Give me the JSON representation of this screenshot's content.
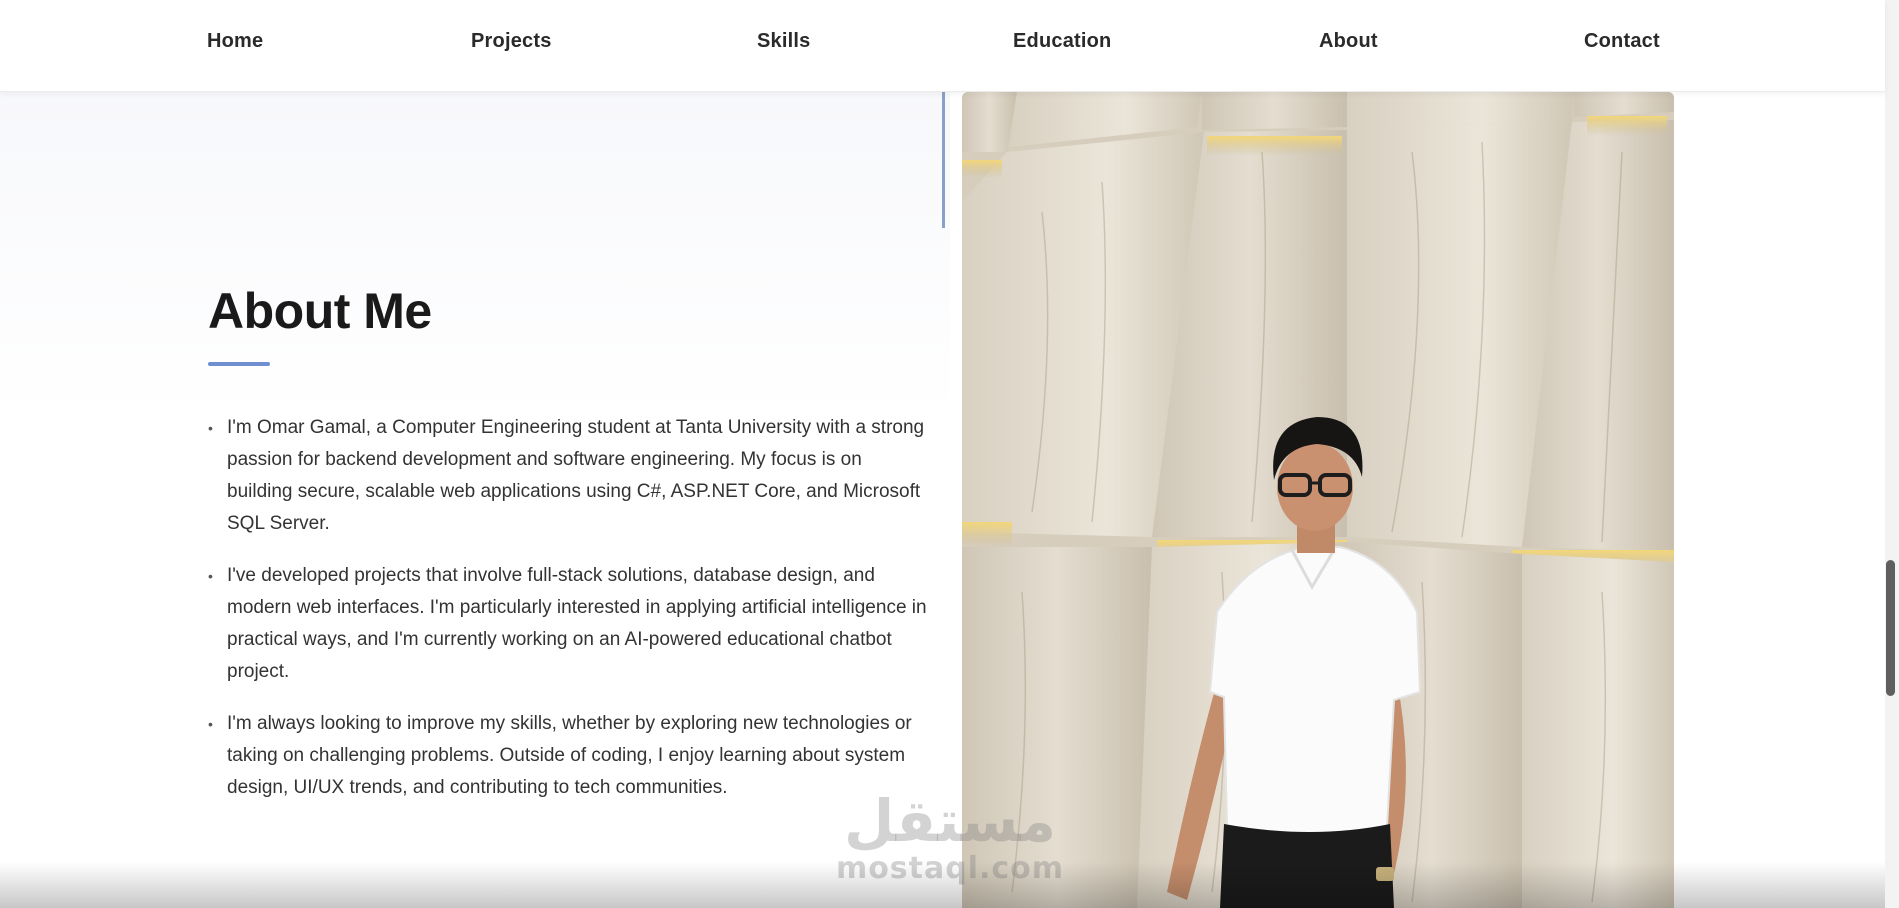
{
  "nav": {
    "home": "Home",
    "projects": "Projects",
    "skills": "Skills",
    "education": "Education",
    "about": "About",
    "contact": "Contact"
  },
  "about": {
    "title": "About Me",
    "bullets": [
      "I'm Omar Gamal, a Computer Engineering student at Tanta University with a strong passion for backend development and software engineering. My focus is on building secure, scalable web applications using C#, ASP.NET Core, and Microsoft SQL Server.",
      "I've developed projects that involve full-stack solutions, database design, and modern web interfaces. I'm particularly interested in applying artificial intelligence in practical ways, and I'm currently working on an AI-powered educational chatbot project.",
      "I'm always looking to improve my skills, whether by exploring new technologies or taking on challenging problems. Outside of coding, I enjoy learning about system design, UI/UX trends, and contributing to tech communities."
    ]
  },
  "watermark": {
    "arabic": "مستقل",
    "latin": "mostaql.com"
  },
  "colors": {
    "accent": "#6f8fd1",
    "text": "#333333",
    "heading": "#1a1a1a"
  }
}
